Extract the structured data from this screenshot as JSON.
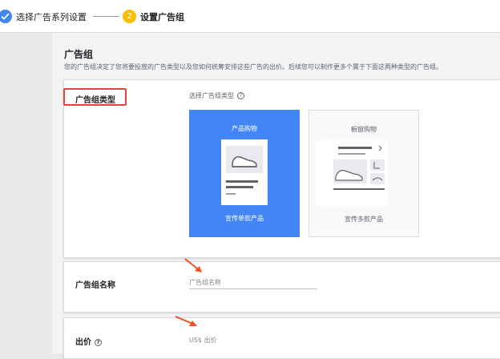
{
  "stepper": {
    "step1_label": "选择广告系列设置",
    "step2_number": "2",
    "step2_label": "设置广告组"
  },
  "ad_group": {
    "title": "广告组",
    "description": "您的广告组决定了您将要投放的广告类型以及您如何统筹安排这些广告的出价。后续您可以制作更多个属于下面这两种类型的广告组。"
  },
  "ad_group_type": {
    "label": "广告组类型",
    "select_label": "选择广告组类型",
    "options": [
      {
        "title": "产品购物",
        "subtitle": "宣传单款产品",
        "selected": true
      },
      {
        "title": "橱窗购物",
        "subtitle": "宣传多款产品",
        "selected": false
      }
    ]
  },
  "ad_group_name": {
    "label": "广告组名称",
    "placeholder": "广告组名称"
  },
  "bid": {
    "label": "出价",
    "placeholder": "US$ 出价"
  },
  "colors": {
    "accent_blue": "#4285f4",
    "highlight_red": "#ea4335",
    "step_yellow": "#fbbc04",
    "arrow_orange": "#f4511e"
  }
}
